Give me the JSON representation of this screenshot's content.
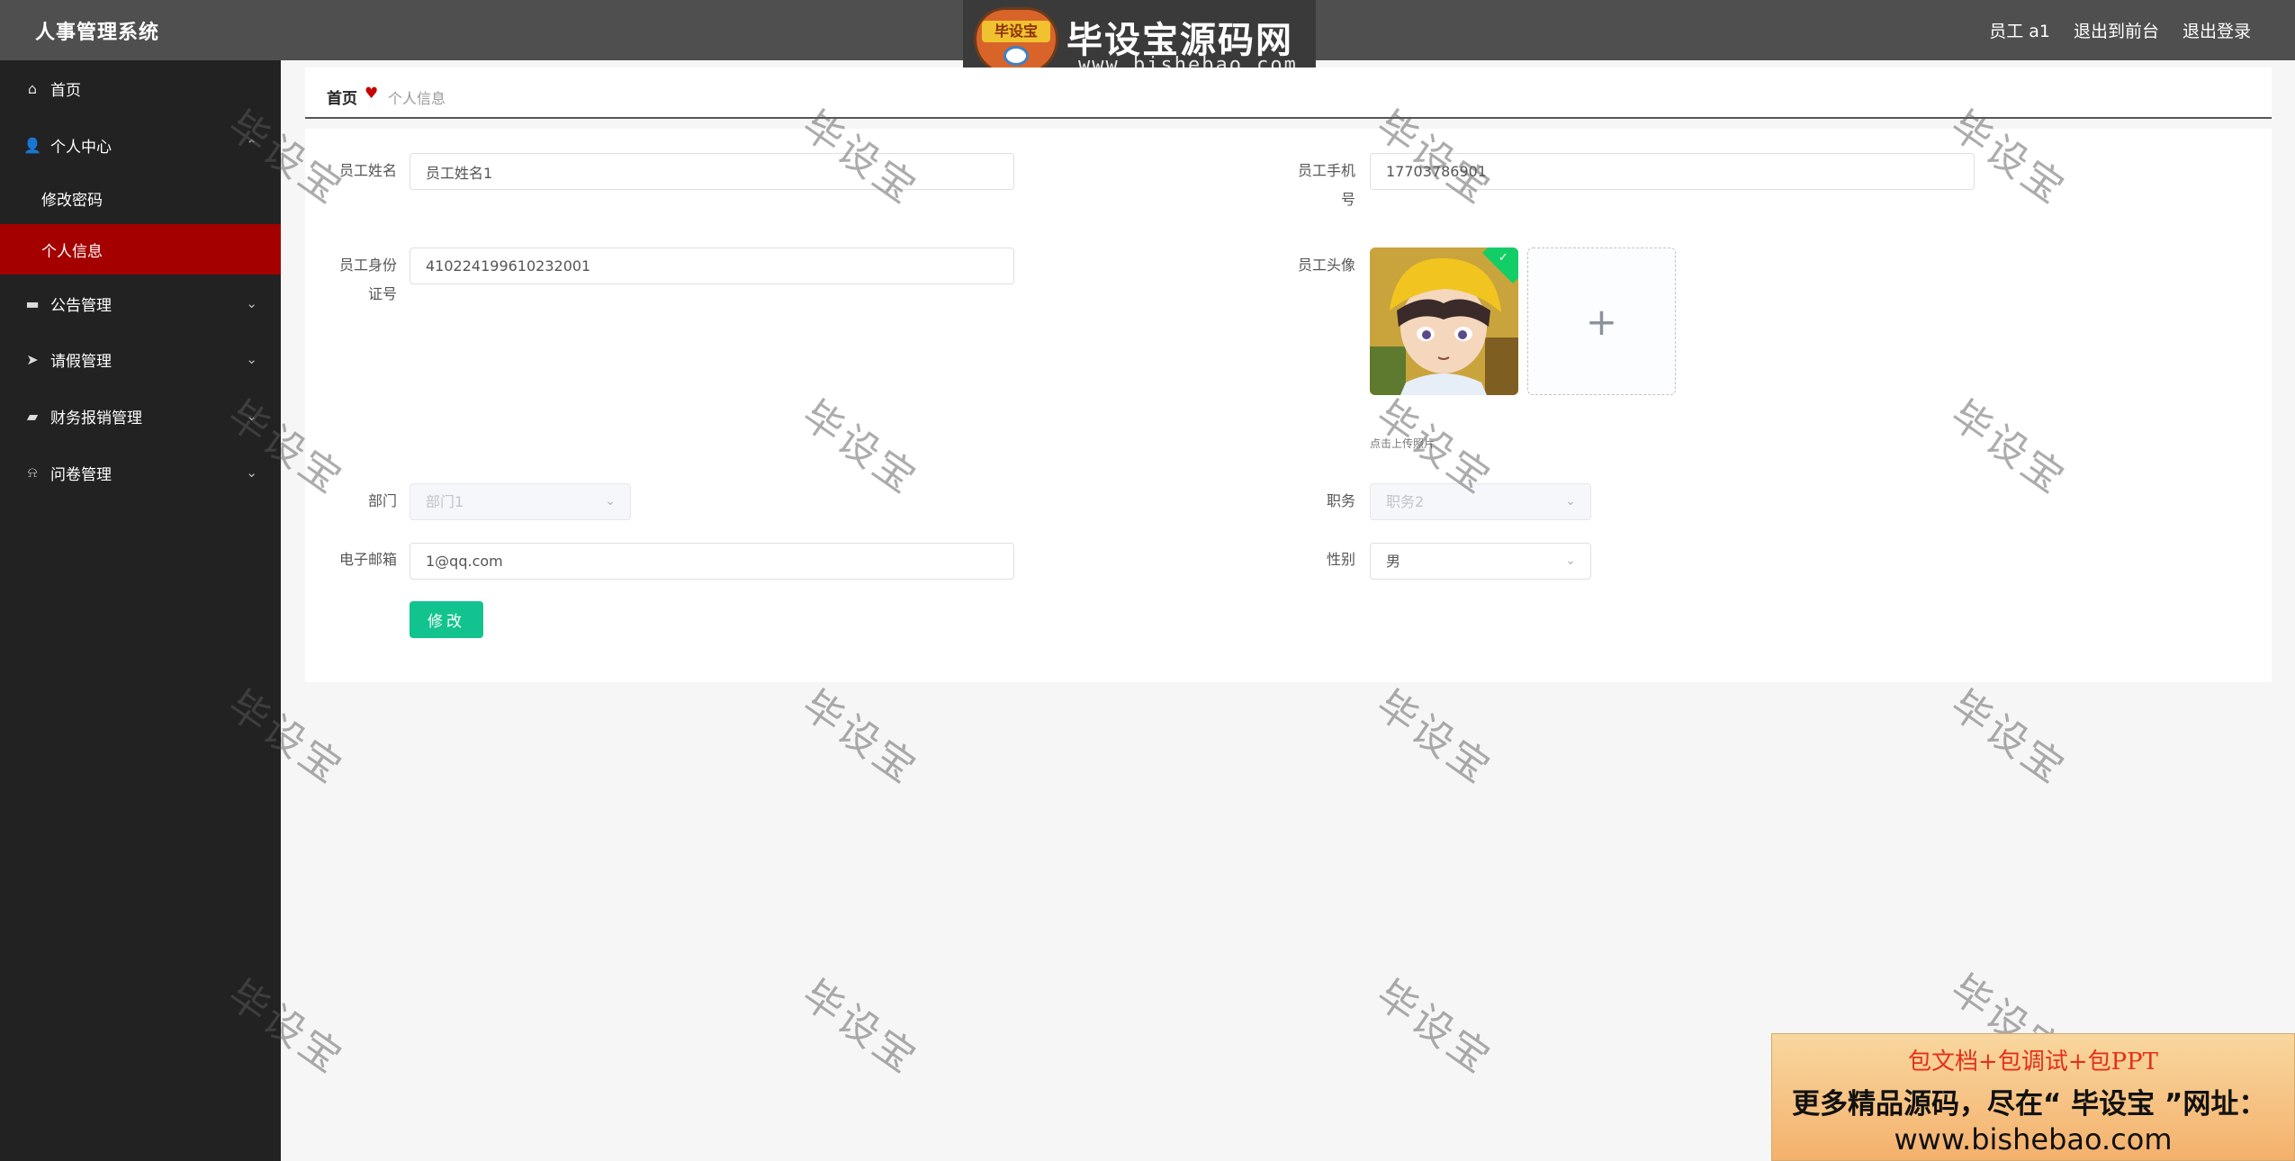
{
  "header": {
    "app_title": "人事管理系统",
    "links": [
      "员工 a1",
      "退出到前台",
      "退出登录"
    ]
  },
  "watermark_banner": {
    "logo_text": "毕设宝",
    "brand": "毕设宝源码网",
    "url": "www.bishebao.com"
  },
  "sidebar": {
    "items": [
      {
        "label": "首页",
        "icon": "home-icon",
        "glyph": "⌂"
      },
      {
        "label": "个人中心",
        "icon": "user-icon",
        "glyph": "👤",
        "arrow": "⌃"
      },
      {
        "label": "修改密码"
      },
      {
        "label": "个人信息"
      },
      {
        "label": "公告管理",
        "icon": "monitor-icon",
        "glyph": "▬",
        "arrow": "⌄"
      },
      {
        "label": "请假管理",
        "icon": "send-icon",
        "glyph": "➤",
        "arrow": "⌄"
      },
      {
        "label": "财务报销管理",
        "icon": "briefcase-icon",
        "glyph": "▰",
        "arrow": "⌄"
      },
      {
        "label": "问卷管理",
        "icon": "bell-icon",
        "glyph": "⍾",
        "arrow": "⌄"
      }
    ]
  },
  "breadcrumb": {
    "home": "首页",
    "current": "个人信息"
  },
  "form": {
    "name_label": "员工姓名",
    "name_value": "员工姓名1",
    "phone_label_1": "员工手机",
    "phone_label_2": "号",
    "phone_value": "17703786901",
    "id_label_1": "员工身份",
    "id_label_2": "证号",
    "id_value": "410224199610232001",
    "avatar_label": "员工头像",
    "upload_tip": "点击上传照片",
    "dept_label": "部门",
    "dept_value": "部门1",
    "post_label": "职务",
    "post_value": "职务2",
    "email_label": "电子邮箱",
    "email_value": "1@qq.com",
    "gender_label": "性别",
    "gender_value": "男",
    "submit_label": "修改"
  },
  "watermark_text": "毕设宝",
  "ad_banner": {
    "line1": "包文档+包调试+包PPT",
    "line2": "更多精品源码，尽在“ 毕设宝 ”网址：",
    "line3": "www.bishebao.com"
  }
}
